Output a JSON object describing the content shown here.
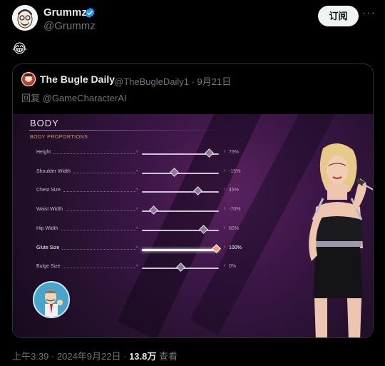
{
  "post": {
    "author_name": "Grummz",
    "author_handle": "@Grummz",
    "follow_label": "订阅",
    "more_label": "···",
    "body_emoji": "😂",
    "footer": {
      "time": "上午3:39",
      "sep1": " · ",
      "date": "2024年9月22日",
      "sep2": " · ",
      "views": "13.8万",
      "views_label": " 查看"
    }
  },
  "quote": {
    "author_name": "The Bugle Daily",
    "author_handle": "@TheBugleDaily1",
    "sep": " · ",
    "date": "9月21日",
    "reply_prefix": "回复 ",
    "reply_to": "@GameCharacterAI"
  },
  "game_ui": {
    "title": "BODY",
    "subtitle": "BODY PROPORTIONS",
    "sliders": [
      {
        "label": "Height",
        "value": "75%",
        "level": 0.87
      },
      {
        "label": "Shoulder Width",
        "value": "-15%",
        "level": 0.42
      },
      {
        "label": "Chest Size",
        "value": "45%",
        "level": 0.72
      },
      {
        "label": "Waist Width",
        "value": "-70%",
        "level": 0.15
      },
      {
        "label": "Hip Width",
        "value": "60%",
        "level": 0.8
      },
      {
        "label": "Glute Size",
        "value": "100%",
        "level": 0.96,
        "active": true
      },
      {
        "label": "Bulge Size",
        "value": "0%",
        "level": 0.5
      }
    ]
  },
  "colors": {
    "verified": "#1d9bf0",
    "accent_subtitle": "#d69a62"
  }
}
